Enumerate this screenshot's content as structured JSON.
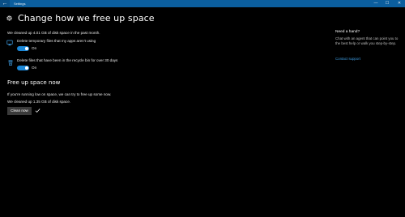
{
  "window": {
    "title": "Settings",
    "back_glyph": "←",
    "controls": {
      "minimize": "—",
      "maximize": "☐",
      "close": "✕"
    }
  },
  "page": {
    "title": "Change how we free up space",
    "title_icon": "gear-icon",
    "summary": "We cleaned up 4.01 GB of disk space in the past month."
  },
  "options": [
    {
      "icon": "monitor-icon",
      "label": "Delete temporary files that my apps aren't using",
      "state": "On",
      "enabled": true
    },
    {
      "icon": "recycle-bin-icon",
      "label": "Delete files that have been in the recycle bin for over 30 days",
      "state": "On",
      "enabled": true
    }
  ],
  "free_up": {
    "title": "Free up space now",
    "description": "If you're running low on space, we can try to free up some now.",
    "result": "We cleaned up 1.35 GB of disk space.",
    "button_label": "Clean now",
    "status_icon": "checkmark-icon"
  },
  "help": {
    "title": "Need a hand?",
    "text": "Chat with an agent that can point you to the best help or walk you step-by-step.",
    "link": "Contact support"
  },
  "colors": {
    "titlebar": "#0b5e9e",
    "accent": "#1b87d6",
    "link": "#3c9ade",
    "background": "#000000",
    "button": "#3a3a3a"
  }
}
